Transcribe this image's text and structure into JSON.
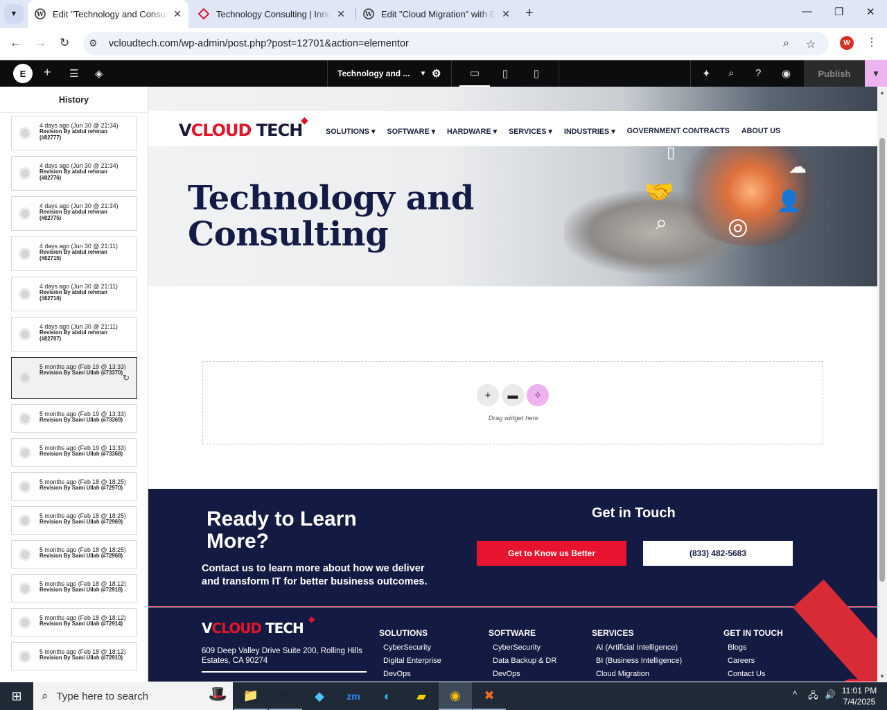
{
  "browser": {
    "tabs": [
      {
        "title": "Edit \"Technology and Consulting\"",
        "active": true,
        "icon": "wordpress-icon"
      },
      {
        "title": "Technology Consulting | Innovative",
        "active": false,
        "icon": "vcloud-diamond-icon"
      },
      {
        "title": "Edit \"Cloud Migration\" with Elementor",
        "active": false,
        "icon": "wordpress-icon"
      }
    ],
    "url": "vcloudtech.com/wp-admin/post.php?post=12701&action=elementor",
    "profile_initial": "W"
  },
  "elementor": {
    "document_title": "Technology and ...",
    "publish_label": "Publish",
    "accent_color": "#ecb3ee"
  },
  "history": {
    "title": "History",
    "items": [
      {
        "time": "4 days ago (Jun 30 @ 21:34)",
        "by": "Revision By abdul rehman (#82777)"
      },
      {
        "time": "4 days ago (Jun 30 @ 21:34)",
        "by": "Revision By abdul rehman (#82776)"
      },
      {
        "time": "4 days ago (Jun 30 @ 21:34)",
        "by": "Revision By abdul rehman (#82775)"
      },
      {
        "time": "4 days ago (Jun 30 @ 21:11)",
        "by": "Revision By abdul rehman (#82715)"
      },
      {
        "time": "4 days ago (Jun 30 @ 21:11)",
        "by": "Revision By abdul rehman (#82710)"
      },
      {
        "time": "4 days ago (Jun 30 @ 21:11)",
        "by": "Revision By abdul rehman (#82707)"
      },
      {
        "time": "5 months ago (Feb 19 @ 13:33)",
        "by": "Revision By Sami Ullah (#73370)",
        "current": true
      },
      {
        "time": "5 months ago (Feb 19 @ 13:33)",
        "by": "Revision By Sami Ullah (#73369)"
      },
      {
        "time": "5 months ago (Feb 19 @ 13:33)",
        "by": "Revision By Sami Ullah (#73368)"
      },
      {
        "time": "5 months ago (Feb 18 @ 18:25)",
        "by": "Revision By Sami Ullah (#72970)"
      },
      {
        "time": "5 months ago (Feb 18 @ 18:25)",
        "by": "Revision By Sami Ullah (#72969)"
      },
      {
        "time": "5 months ago (Feb 18 @ 18:25)",
        "by": "Revision By Sami Ullah (#72968)"
      },
      {
        "time": "5 months ago (Feb 18 @ 18:12)",
        "by": "Revision By Sami Ullah (#72918)"
      },
      {
        "time": "5 months ago (Feb 18 @ 18:12)",
        "by": "Revision By Sami Ullah (#72914)"
      },
      {
        "time": "5 months ago (Feb 18 @ 18:12)",
        "by": "Revision By Sami Ullah (#72910)"
      }
    ]
  },
  "site": {
    "logo_left": "V",
    "logo_red": "CLOUD",
    "logo_right": " TECH",
    "menu": [
      "SOLUTIONS ▾",
      "SOFTWARE ▾",
      "HARDWARE ▾",
      "SERVICES ▾",
      "INDUSTRIES ▾",
      "GOVERNMENT CONTRACTS",
      "ABOUT US"
    ],
    "hero_title_line1": "Technology and",
    "hero_title_line2": "Consulting",
    "dropzone_text": "Drag widget here",
    "cta": {
      "heading_line1": "Ready to Learn",
      "heading_line2": "More?",
      "text": "Contact us to learn more about how we deliver and transform IT for better business outcomes.",
      "get_in_touch": "Get in Touch",
      "primary_button": "Get to Know us Better",
      "phone_button": "(833) 482-5683"
    },
    "footer": {
      "address": "609 Deep Valley Drive Suite 200, Rolling Hills Estates, CA 90274",
      "columns": [
        {
          "heading": "SOLUTIONS",
          "items": [
            "CyberSecurity",
            "Digital Enterprise",
            "DevOps"
          ]
        },
        {
          "heading": "SOFTWARE",
          "items": [
            "CyberSecurity",
            "Data Backup & DR",
            "DevOps"
          ]
        },
        {
          "heading": "SERVICES",
          "items": [
            "AI (Artificial Intelligence)",
            "BI (Business Intelligence)",
            "Cloud Migration"
          ]
        },
        {
          "heading": "GET IN TOUCH",
          "items": [
            "Blogs",
            "Careers",
            "Contact Us"
          ]
        }
      ]
    },
    "brand_colors": {
      "navy": "#141b42",
      "red": "#e8132e"
    }
  },
  "taskbar": {
    "search_placeholder": "Type here to search",
    "time": "11:01 PM",
    "date": "7/4/2025"
  }
}
